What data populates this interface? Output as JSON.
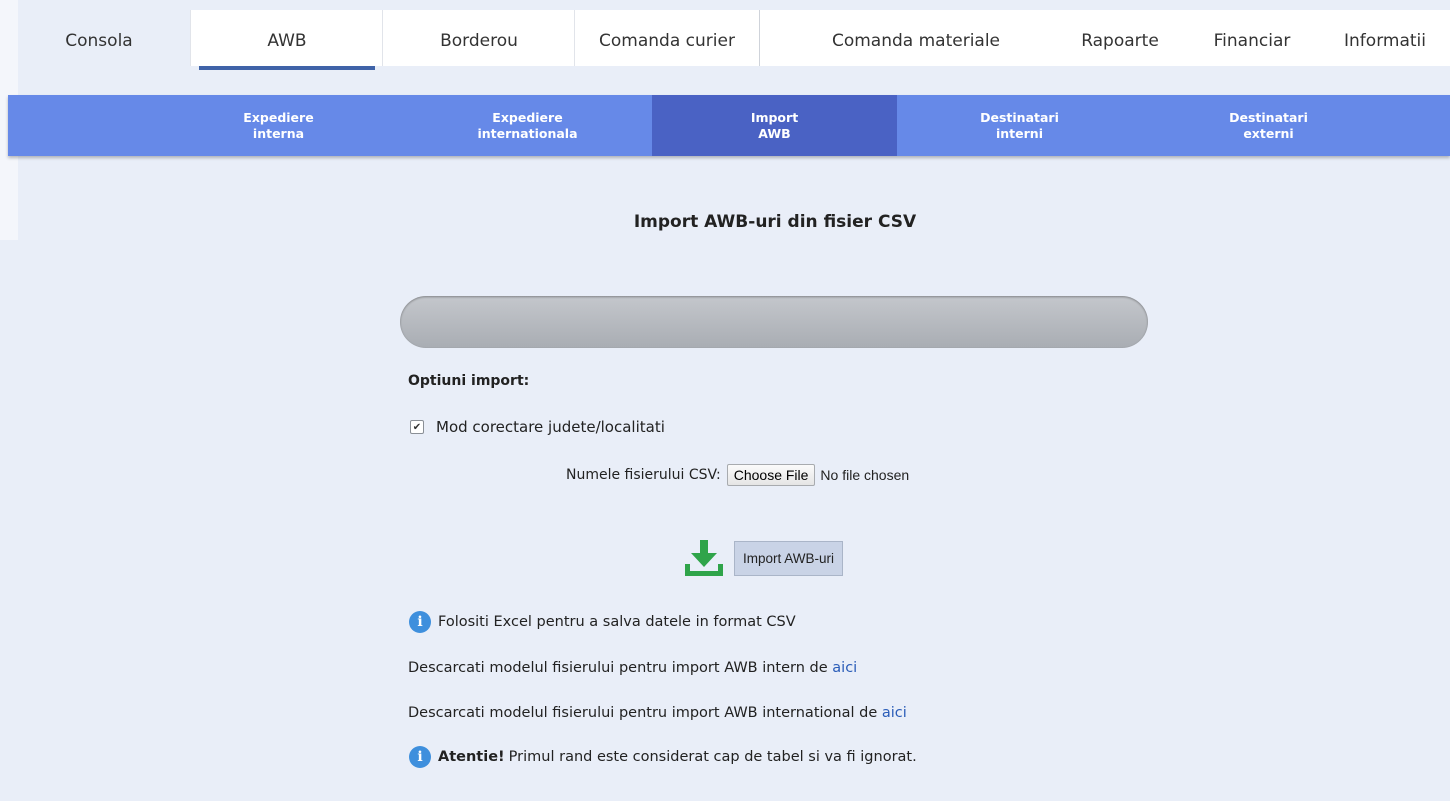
{
  "top_nav": {
    "tabs": [
      {
        "label": "Consola"
      },
      {
        "label": "AWB"
      },
      {
        "label": "Borderou"
      },
      {
        "label": "Comanda curier"
      },
      {
        "label": "Comanda materiale"
      },
      {
        "label": "Rapoarte"
      },
      {
        "label": "Financiar"
      },
      {
        "label": "Informatii"
      }
    ],
    "active_tab": "AWB"
  },
  "sub_nav": {
    "items": [
      {
        "line1": "Expediere",
        "line2": "interna"
      },
      {
        "line1": "Expediere",
        "line2": "internationala"
      },
      {
        "line1": "Import",
        "line2": "AWB"
      },
      {
        "line1": "Destinatari",
        "line2": "interni"
      },
      {
        "line1": "Destinatari",
        "line2": "externi"
      }
    ],
    "active_item": "Import AWB"
  },
  "main": {
    "title": "Import AWB-uri din fisier CSV",
    "progress": 0,
    "options_title": "Optiuni import:",
    "checkbox_label": "Mod corectare judete/localitati",
    "checkbox_checked": true,
    "file_label": "Numele fisierului CSV:",
    "choose_file_label": "Choose File",
    "no_file_text": "No file chosen",
    "import_button": "Import AWB-uri",
    "info_excel": "Folositi Excel pentru a salva datele in format CSV",
    "download_intern_text": "Descarcati modelul fisierului pentru import AWB intern de",
    "download_international_text": "Descarcati modelul fisierului pentru import AWB international de",
    "link_text": "aici",
    "attention_bold": "Atentie!",
    "attention_text": "Primul rand este considerat cap de tabel si va fi ignorat."
  },
  "colors": {
    "subnav_bg": "#6689e8",
    "subnav_active": "#4a62c4",
    "active_underline": "#3f63a8",
    "download_icon": "#2fa44a",
    "info_icon": "#3e8fdd",
    "link": "#2a5cb8"
  },
  "icons": [
    "download-icon",
    "info-icon"
  ]
}
